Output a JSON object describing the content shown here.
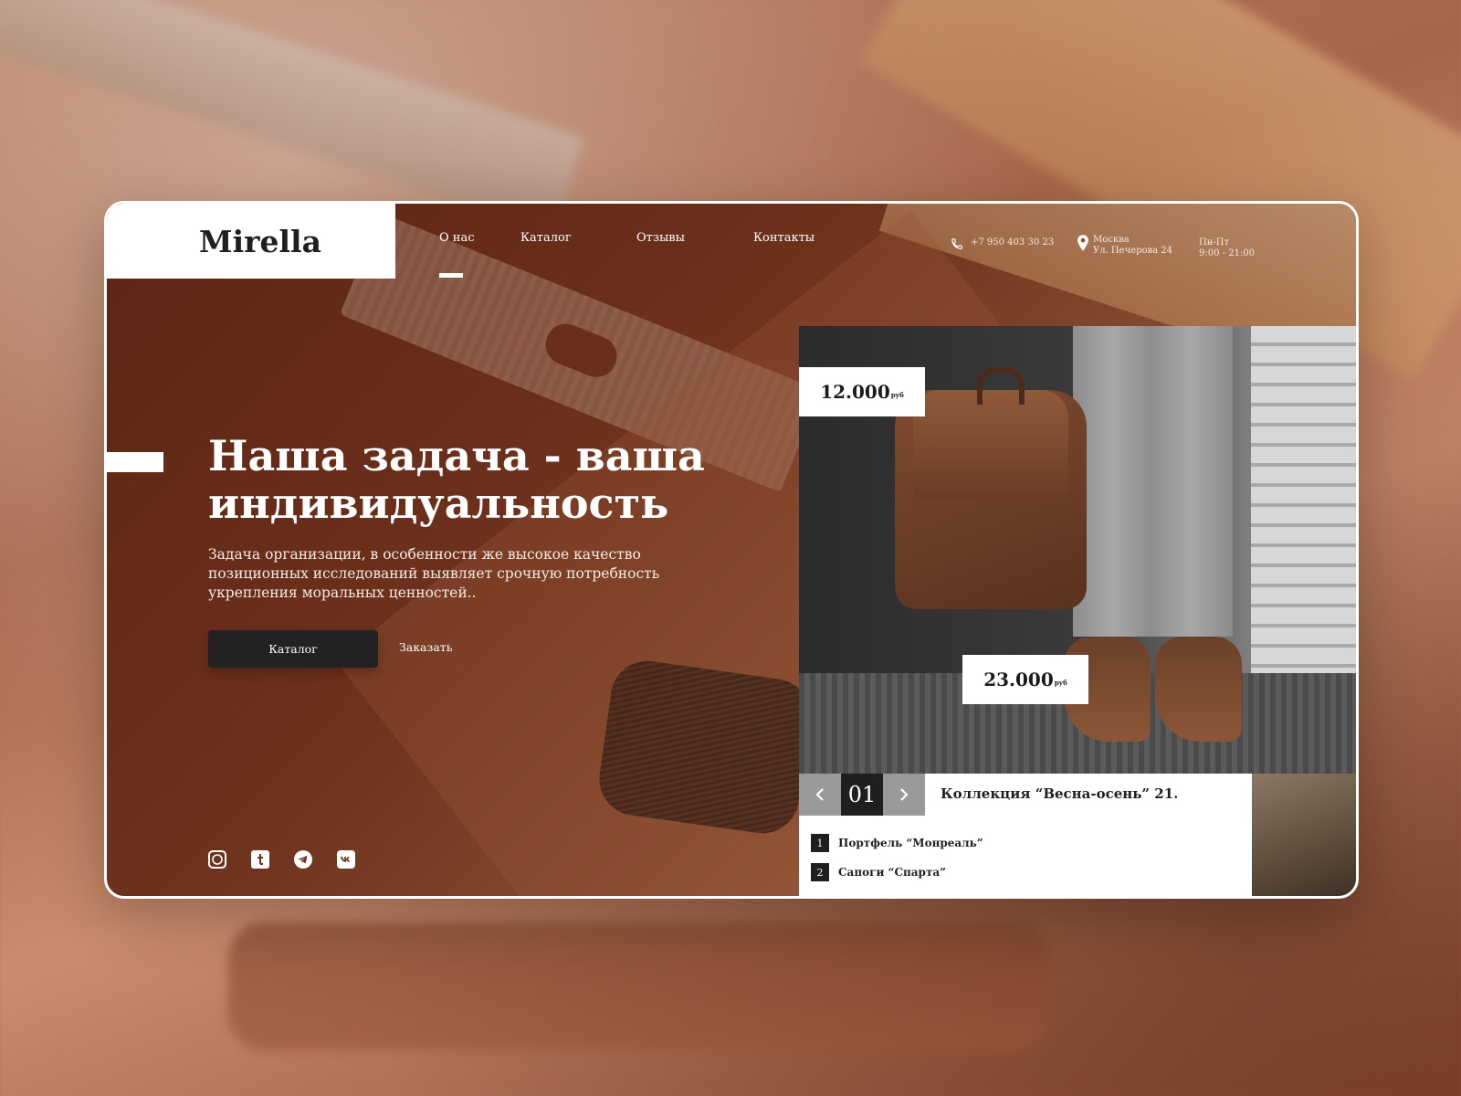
{
  "brand": {
    "logo": "Mirella"
  },
  "nav": {
    "items": [
      {
        "label": "О нас",
        "active": true
      },
      {
        "label": "Каталог"
      },
      {
        "label": "Отзывы"
      },
      {
        "label": "Контакты"
      }
    ]
  },
  "contacts": {
    "phone": "+7 950 403 30 23",
    "address_city": "Москва",
    "address_street": "Ул. Печерова 24",
    "hours_days": "Пн-Пт",
    "hours_time": "9:00 - 21:00"
  },
  "hero": {
    "headline_line1": "Наша задача - ваша",
    "headline_line2": "индивидуальность",
    "subtext": "Задача организации, в особенности же высокое качество позиционных исследований выявляет срочную потребность укрепления моральных ценностей..",
    "primary_button": "Каталог",
    "secondary_button": "Заказать"
  },
  "social": {
    "icons": [
      "whatsapp-icon",
      "tumblr-icon",
      "telegram-icon",
      "vk-icon"
    ]
  },
  "product": {
    "price_1": {
      "amount": "12.000",
      "unit": "руб"
    },
    "price_2": {
      "amount": "23.000",
      "unit": "руб"
    },
    "slide_number": "01",
    "collection_title": "Коллекция “Весна-осень” 21.",
    "items": [
      {
        "num": "1",
        "label": "Портфель “Монреаль”"
      },
      {
        "num": "2",
        "label": "Сапоги “Спарта”"
      }
    ]
  },
  "colors": {
    "accent_dark": "#1f1f1f",
    "brand_brown": "#6e321d",
    "white": "#ffffff"
  }
}
